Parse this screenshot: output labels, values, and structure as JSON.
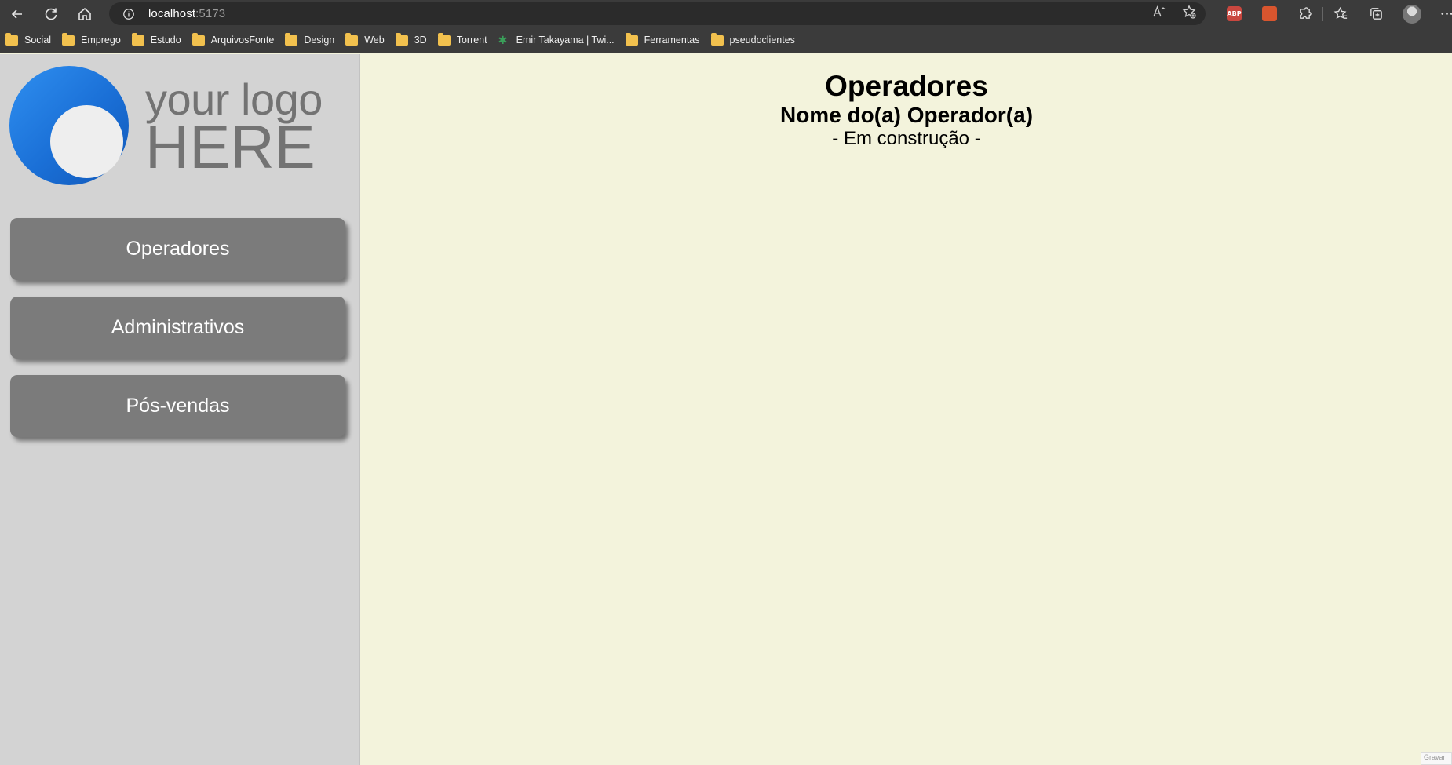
{
  "browser": {
    "url_host": "localhost",
    "url_port": ":5173",
    "bookmarks": [
      {
        "label": "Social",
        "icon": "folder-icon"
      },
      {
        "label": "Emprego",
        "icon": "folder-icon"
      },
      {
        "label": "Estudo",
        "icon": "folder-icon"
      },
      {
        "label": "ArquivosFonte",
        "icon": "folder-icon"
      },
      {
        "label": "Design",
        "icon": "folder-icon"
      },
      {
        "label": "Web",
        "icon": "folder-icon"
      },
      {
        "label": "3D",
        "icon": "folder-icon"
      },
      {
        "label": "Torrent",
        "icon": "folder-icon"
      },
      {
        "label": "Emir Takayama | Twi...",
        "icon": "leaf-icon"
      },
      {
        "label": "Ferramentas",
        "icon": "folder-icon"
      },
      {
        "label": "pseudoclientes",
        "icon": "folder-icon"
      }
    ],
    "abp_label": "ABP"
  },
  "sidebar": {
    "logo": {
      "line1": "your logo",
      "line2": "HERE"
    },
    "items": [
      {
        "label": "Operadores"
      },
      {
        "label": "Administrativos"
      },
      {
        "label": "Pós-vendas"
      }
    ]
  },
  "main": {
    "title": "Operadores",
    "subtitle": "Nome do(a) Operador(a)",
    "status": "- Em construção -"
  },
  "corner_label": "Gravar"
}
